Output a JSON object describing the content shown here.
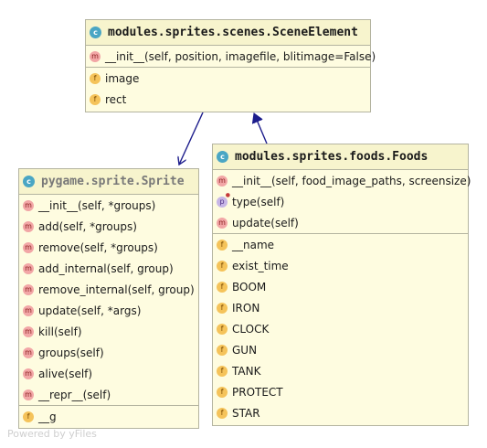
{
  "colors": {
    "header_bg": "#f7f4cd",
    "body_bg": "#fefce0",
    "border": "#b4b4a0",
    "edge": "#1d1d8c",
    "class_badge": "#4aa6c4",
    "method_badge": "#f2a6a6",
    "field_badge": "#f5c35a",
    "property_badge": "#c7b6e6"
  },
  "classes": {
    "scene_element": {
      "icon": "class-icon",
      "name": "modules.sprites.scenes.SceneElement",
      "methods": [
        {
          "kind": "m",
          "icon": "method-icon",
          "text": "__init__(self, position, imagefile, blitimage=False)"
        }
      ],
      "fields": [
        {
          "kind": "f",
          "icon": "field-icon",
          "text": "image"
        },
        {
          "kind": "f",
          "icon": "field-icon",
          "text": "rect"
        }
      ]
    },
    "sprite": {
      "icon": "class-icon",
      "name": "pygame.sprite.Sprite",
      "methods": [
        {
          "kind": "m",
          "icon": "method-icon",
          "text": "__init__(self, *groups)"
        },
        {
          "kind": "m",
          "icon": "method-icon",
          "text": "add(self, *groups)"
        },
        {
          "kind": "m",
          "icon": "method-icon",
          "text": "remove(self, *groups)"
        },
        {
          "kind": "m",
          "icon": "method-icon",
          "text": "add_internal(self, group)"
        },
        {
          "kind": "m",
          "icon": "method-icon",
          "text": "remove_internal(self, group)"
        },
        {
          "kind": "m",
          "icon": "method-icon",
          "text": "update(self, *args)"
        },
        {
          "kind": "m",
          "icon": "method-icon",
          "text": "kill(self)"
        },
        {
          "kind": "m",
          "icon": "method-icon",
          "text": "groups(self)"
        },
        {
          "kind": "m",
          "icon": "method-icon",
          "text": "alive(self)"
        },
        {
          "kind": "m",
          "icon": "method-icon",
          "text": "__repr__(self)"
        }
      ],
      "fields": [
        {
          "kind": "f",
          "icon": "field-icon",
          "text": "__g"
        }
      ]
    },
    "foods": {
      "icon": "class-icon",
      "name": "modules.sprites.foods.Foods",
      "methods": [
        {
          "kind": "m",
          "icon": "method-icon",
          "text": "__init__(self, food_image_paths, screensize)"
        },
        {
          "kind": "p",
          "icon": "property-icon",
          "text": "type(self)"
        },
        {
          "kind": "m",
          "icon": "method-icon",
          "text": "update(self)"
        }
      ],
      "fields": [
        {
          "kind": "f",
          "icon": "field-icon",
          "text": "__name"
        },
        {
          "kind": "f",
          "icon": "field-icon",
          "text": "exist_time"
        },
        {
          "kind": "f",
          "icon": "field-icon",
          "text": "BOOM"
        },
        {
          "kind": "f",
          "icon": "field-icon",
          "text": "IRON"
        },
        {
          "kind": "f",
          "icon": "field-icon",
          "text": "CLOCK"
        },
        {
          "kind": "f",
          "icon": "field-icon",
          "text": "GUN"
        },
        {
          "kind": "f",
          "icon": "field-icon",
          "text": "TANK"
        },
        {
          "kind": "f",
          "icon": "field-icon",
          "text": "PROTECT"
        },
        {
          "kind": "f",
          "icon": "field-icon",
          "text": "STAR"
        }
      ]
    }
  },
  "edges": [
    {
      "from": "scene_element",
      "to": "sprite",
      "type": "association-arrow"
    },
    {
      "from": "foods",
      "to": "scene_element",
      "type": "inheritance-arrow"
    }
  ],
  "watermark": "Powered by yFiles"
}
